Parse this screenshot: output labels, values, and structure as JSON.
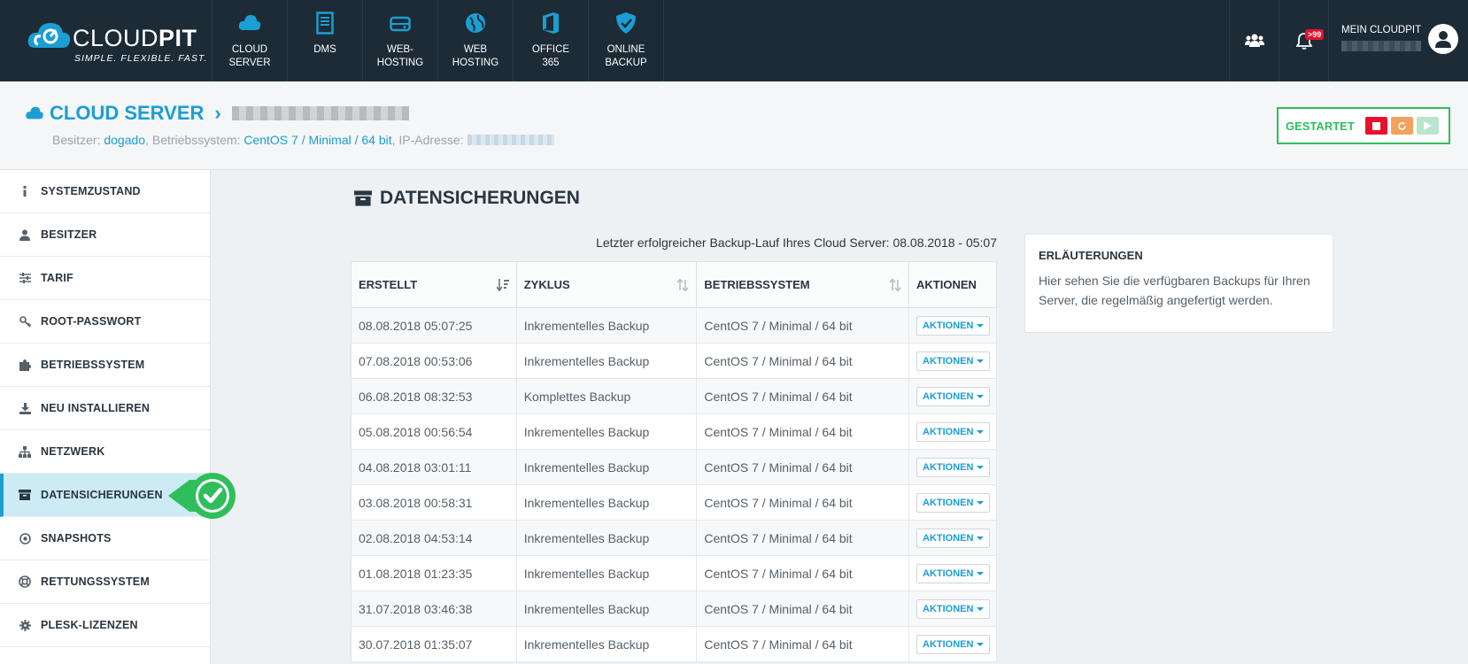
{
  "brand": {
    "name_part1": "CLOUD",
    "name_part2": "PIT",
    "tagline": "SIMPLE. FLEXIBLE. FAST."
  },
  "topnav": [
    {
      "label": "CLOUD\nSERVER",
      "icon": "cloud-icon"
    },
    {
      "label": "DMS",
      "icon": "document-icon"
    },
    {
      "label": "WEB-\nHOSTING",
      "icon": "hard-drive-icon"
    },
    {
      "label": "WEB\nHOSTING",
      "icon": "globe-icon"
    },
    {
      "label": "OFFICE\n365",
      "icon": "office-icon"
    },
    {
      "label": "ONLINE\nBACKUP",
      "icon": "shield-icon"
    }
  ],
  "topright": {
    "notification_count": ">99",
    "account_label": "MEIN CLOUDPIT"
  },
  "header": {
    "title": "CLOUD SERVER",
    "owner_label": "Besitzer:",
    "owner_value": "dogado",
    "os_label": ", Betriebssystem:",
    "os_value": "CentOS 7 / Minimal / 64 bit",
    "ip_label": ", IP-Adresse:"
  },
  "status": {
    "label": "GESTARTET"
  },
  "sidebar": {
    "items": [
      {
        "label": "SYSTEMZUSTAND",
        "icon": "info-icon"
      },
      {
        "label": "BESITZER",
        "icon": "user-icon"
      },
      {
        "label": "TARIF",
        "icon": "sliders-icon"
      },
      {
        "label": "ROOT-PASSWORT",
        "icon": "key-icon"
      },
      {
        "label": "BETRIEBSSYSTEM",
        "icon": "puzzle-icon"
      },
      {
        "label": "NEU INSTALLIEREN",
        "icon": "download-icon"
      },
      {
        "label": "NETZWERK",
        "icon": "sitemap-icon"
      },
      {
        "label": "DATENSICHERUNGEN",
        "icon": "archive-icon"
      },
      {
        "label": "SNAPSHOTS",
        "icon": "dot-circle-icon"
      },
      {
        "label": "RETTUNGSSYSTEM",
        "icon": "life-ring-icon"
      },
      {
        "label": "PLESK-LIZENZEN",
        "icon": "gear-icon"
      }
    ]
  },
  "main": {
    "title": "DATENSICHERUNGEN",
    "last_backup": "Letzter erfolgreicher Backup-Lauf Ihres Cloud Server: 08.08.2018 - 05:07",
    "table": {
      "headers": [
        "ERSTELLT",
        "ZYKLUS",
        "BETRIEBSSYSTEM",
        "AKTIONEN"
      ],
      "action_label": "AKTIONEN",
      "rows": [
        [
          "08.08.2018 05:07:25",
          "Inkrementelles Backup",
          "CentOS 7 / Minimal / 64 bit"
        ],
        [
          "07.08.2018 00:53:06",
          "Inkrementelles Backup",
          "CentOS 7 / Minimal / 64 bit"
        ],
        [
          "06.08.2018 08:32:53",
          "Komplettes Backup",
          "CentOS 7 / Minimal / 64 bit"
        ],
        [
          "05.08.2018 00:56:54",
          "Inkrementelles Backup",
          "CentOS 7 / Minimal / 64 bit"
        ],
        [
          "04.08.2018 03:01:11",
          "Inkrementelles Backup",
          "CentOS 7 / Minimal / 64 bit"
        ],
        [
          "03.08.2018 00:58:31",
          "Inkrementelles Backup",
          "CentOS 7 / Minimal / 64 bit"
        ],
        [
          "02.08.2018 04:53:14",
          "Inkrementelles Backup",
          "CentOS 7 / Minimal / 64 bit"
        ],
        [
          "01.08.2018 01:23:35",
          "Inkrementelles Backup",
          "CentOS 7 / Minimal / 64 bit"
        ],
        [
          "31.07.2018 03:46:38",
          "Inkrementelles Backup",
          "CentOS 7 / Minimal / 64 bit"
        ],
        [
          "30.07.2018 01:35:07",
          "Inkrementelles Backup",
          "CentOS 7 / Minimal / 64 bit"
        ]
      ]
    }
  },
  "info": {
    "title": "ERLÄUTERUNGEN",
    "text": "Hier sehen Sie die verfügbaren Backups für Ihren Server, die regelmäßig angefertigt werden."
  },
  "colors": {
    "accent": "#1b9ed3",
    "topbar": "#1c2b36",
    "success": "#2fbe5c",
    "danger": "#e8112d",
    "warning": "#f2a25c"
  }
}
